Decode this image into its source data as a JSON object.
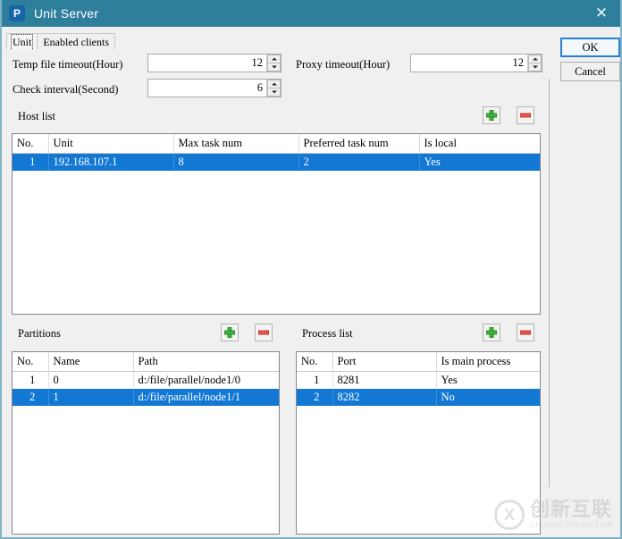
{
  "window": {
    "title": "Unit Server",
    "icon": "app-p-icon",
    "close_label": "✕",
    "titlebar_color": "#2e7f9c"
  },
  "tabs": [
    {
      "label": "Unit",
      "selected": true
    },
    {
      "label": "Enabled clients",
      "selected": false
    }
  ],
  "form": {
    "temp_file_timeout": {
      "label": "Temp file timeout(Hour)",
      "value": "12"
    },
    "proxy_timeout": {
      "label": "Proxy timeout(Hour)",
      "value": "12"
    },
    "check_interval": {
      "label": "Check interval(Second)",
      "value": "6"
    }
  },
  "host_list": {
    "title": "Host list",
    "add_label": "+",
    "remove_label": "-",
    "columns": [
      "No.",
      "Unit",
      "Max task num",
      "Preferred task num",
      "Is local"
    ],
    "rows": [
      {
        "no": "1",
        "unit": "192.168.107.1",
        "max_task_num": "8",
        "preferred_task_num": "2",
        "is_local": "Yes",
        "selected": true
      }
    ]
  },
  "partitions": {
    "title": "Partitions",
    "add_label": "+",
    "remove_label": "-",
    "columns": [
      "No.",
      "Name",
      "Path"
    ],
    "rows": [
      {
        "no": "1",
        "name": "0",
        "path": "d:/file/parallel/node1/0",
        "selected": false
      },
      {
        "no": "2",
        "name": "1",
        "path": "d:/file/parallel/node1/1",
        "selected": true
      }
    ]
  },
  "process_list": {
    "title": "Process list",
    "add_label": "+",
    "remove_label": "-",
    "columns": [
      "No.",
      "Port",
      "Is main process"
    ],
    "rows": [
      {
        "no": "1",
        "port": "8281",
        "is_main": "Yes",
        "selected": false
      },
      {
        "no": "2",
        "port": "8282",
        "is_main": "No",
        "selected": true
      }
    ]
  },
  "buttons": {
    "ok": "OK",
    "cancel": "Cancel"
  },
  "watermark": {
    "cn": "创新互联",
    "en": "CHUANG XIN HU LIAN"
  },
  "colors": {
    "selection": "#1278d4",
    "accent": "#2e7f9c",
    "add": "#3fb23f",
    "remove": "#e8584f"
  }
}
